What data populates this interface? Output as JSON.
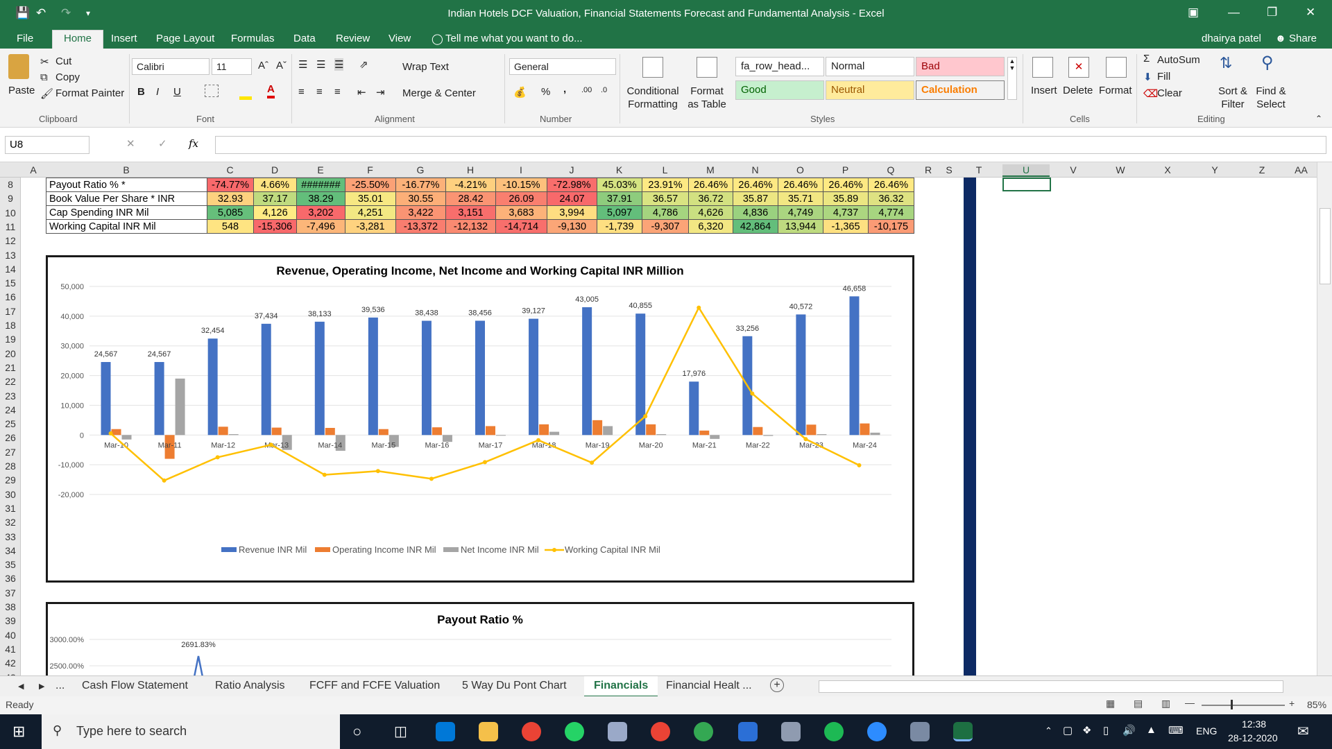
{
  "window": {
    "title": "Indian Hotels DCF Valuation, Financial Statements Forecast and Fundamental Analysis - Excel"
  },
  "menu": {
    "file": "File",
    "tabs": [
      "Home",
      "Insert",
      "Page Layout",
      "Formulas",
      "Data",
      "Review",
      "View"
    ],
    "tell_me": "Tell me what you want to do...",
    "user": "dhairya patel",
    "share": "Share"
  },
  "ribbon": {
    "paste": "Paste",
    "cut": "Cut",
    "copy": "Copy",
    "format_painter": "Format Painter",
    "clipboard": "Clipboard",
    "font_name": "Calibri",
    "font_size": "11",
    "bold": "B",
    "italic": "I",
    "underline": "U",
    "font": "Font",
    "wrap_text": "Wrap Text",
    "merge_center": "Merge & Center",
    "alignment": "Alignment",
    "number_format": "General",
    "percent": "%",
    "comma": ",",
    "number": "Number",
    "conditional_formatting": "Conditional Formatting",
    "format_as_table": "Format as Table",
    "style_names": [
      "fa_row_head...",
      "Normal",
      "Bad",
      "Good",
      "Neutral",
      "Calculation"
    ],
    "styles": "Styles",
    "insert": "Insert",
    "delete": "Delete",
    "format": "Format",
    "cells": "Cells",
    "autosum": "AutoSum",
    "fill": "Fill",
    "clear": "Clear",
    "sort_filter": "Sort & Filter",
    "find_select": "Find & Select",
    "editing": "Editing"
  },
  "formula_bar": {
    "name_box": "U8",
    "fx": "fx",
    "content": ""
  },
  "columns": [
    "A",
    "B",
    "C",
    "D",
    "E",
    "F",
    "G",
    "H",
    "I",
    "J",
    "K",
    "L",
    "M",
    "N",
    "O",
    "P",
    "Q",
    "R",
    "S",
    "T",
    "U",
    "V",
    "W",
    "X",
    "Y",
    "Z",
    "AA"
  ],
  "rows": [
    "8",
    "9",
    "10",
    "11",
    "12",
    "13",
    "14",
    "15",
    "16",
    "17",
    "18",
    "19",
    "20",
    "21",
    "22",
    "23",
    "24",
    "25",
    "26",
    "27",
    "28",
    "29",
    "30",
    "31",
    "32",
    "33",
    "34",
    "35",
    "36",
    "37",
    "38",
    "39",
    "40",
    "41",
    "42",
    "43"
  ],
  "table": [
    {
      "label": "Payout Ratio % *",
      "values": [
        "-74.77%",
        "4.66%",
        "#######",
        "-25.50%",
        "-16.77%",
        "-4.21%",
        "-10.15%",
        "-72.98%",
        "45.03%",
        "23.91%",
        "26.46%",
        "26.46%",
        "26.46%",
        "26.46%",
        "26.46%"
      ],
      "colors": [
        "#f8696b",
        "#fee382",
        "#63be7b",
        "#fba176",
        "#fcb179",
        "#fed07f",
        "#fdc07c",
        "#f86e6c",
        "#d5e382",
        "#fde983",
        "#fee983",
        "#fee983",
        "#fee983",
        "#fee983",
        "#fee983"
      ]
    },
    {
      "label": "Book Value Per Share * INR",
      "values": [
        "32.93",
        "37.17",
        "38.29",
        "35.01",
        "30.55",
        "28.42",
        "26.09",
        "24.07",
        "37.91",
        "36.57",
        "36.72",
        "35.87",
        "35.71",
        "35.89",
        "36.32"
      ],
      "colors": [
        "#fdd17f",
        "#bfdb7f",
        "#63be7b",
        "#f7e883",
        "#fcaf78",
        "#fa9473",
        "#f97f6f",
        "#f8696b",
        "#8ecc7d",
        "#d9e382",
        "#d3e181",
        "#ece682",
        "#f2e783",
        "#ebe682",
        "#dee282"
      ]
    },
    {
      "label": "Cap Spending INR Mil",
      "values": [
        "5,085",
        "4,126",
        "3,202",
        "4,251",
        "3,422",
        "3,151",
        "3,683",
        "3,994",
        "5,097",
        "4,786",
        "4,626",
        "4,836",
        "4,749",
        "4,737",
        "4,774"
      ],
      "colors": [
        "#66bf7b",
        "#feeb84",
        "#f8696b",
        "#f2e883",
        "#fa9473",
        "#f86e6c",
        "#fcb279",
        "#fedd81",
        "#63be7b",
        "#a5d47f",
        "#c9df81",
        "#9ad17f",
        "#aad580",
        "#acd680",
        "#a7d580"
      ]
    },
    {
      "label": "Working Capital INR Mil",
      "values": [
        "548",
        "-15,306",
        "-7,496",
        "-3,281",
        "-13,372",
        "-12,132",
        "-14,714",
        "-9,130",
        "-1,739",
        "-9,307",
        "6,320",
        "42,864",
        "13,944",
        "-1,365",
        "-10,175"
      ],
      "colors": [
        "#fee482",
        "#f8696b",
        "#fcb679",
        "#fed27f",
        "#f97d6f",
        "#fa8a71",
        "#f86f6c",
        "#fba677",
        "#fedf81",
        "#fba477",
        "#f2e783",
        "#63be7b",
        "#bedb80",
        "#fee081",
        "#fb9b75"
      ]
    }
  ],
  "chart_data": [
    {
      "type": "bar",
      "title": "Revenue, Operating Income, Net Income and Working Capital INR Million",
      "categories": [
        "Mar-10",
        "Mar-11",
        "Mar-12",
        "Mar-13",
        "Mar-14",
        "Mar-15",
        "Mar-16",
        "Mar-17",
        "Mar-18",
        "Mar-19",
        "Mar-20",
        "Mar-21",
        "Mar-22",
        "Mar-23",
        "Mar-24"
      ],
      "series": [
        {
          "name": "Revenue INR Mil",
          "type": "bar",
          "color": "#4472c4",
          "values": [
            24567,
            24567,
            32454,
            37434,
            38133,
            39536,
            38438,
            38456,
            39127,
            43005,
            40855,
            17976,
            33256,
            40572,
            46658
          ],
          "labels": [
            "24,567",
            "24,567",
            "32,454",
            "37,434",
            "38,133",
            "39,536",
            "38,438",
            "38,456",
            "39,127",
            "43,005",
            "40,855",
            "17,976",
            "33,256",
            "40,572",
            "46,658"
          ]
        },
        {
          "name": "Operating Income INR Mil",
          "type": "bar",
          "color": "#ed7d31",
          "values": [
            2000,
            -8000,
            2800,
            2500,
            2400,
            2000,
            2600,
            3000,
            3600,
            5000,
            3600,
            1500,
            2700,
            3500,
            3900
          ]
        },
        {
          "name": "Net Income INR Mil",
          "type": "bar",
          "color": "#a5a5a5",
          "values": [
            -1500,
            19000,
            300,
            -5000,
            -5300,
            -4000,
            -2300,
            -200,
            1100,
            3000,
            300,
            -1300,
            -300,
            300,
            800
          ]
        },
        {
          "name": "Working Capital INR Mil",
          "type": "line",
          "color": "#ffc000",
          "values": [
            548,
            -15306,
            -7496,
            -3281,
            -13372,
            -12132,
            -14714,
            -9130,
            -1739,
            -9307,
            6320,
            42864,
            13944,
            -1365,
            -10175
          ]
        }
      ],
      "ylim": [
        -20000,
        50000
      ],
      "yticks": [
        "50,000",
        "40,000",
        "30,000",
        "20,000",
        "10,000",
        "0",
        "-10,000",
        "-20,000"
      ],
      "legend": "bottom"
    },
    {
      "type": "line",
      "title": "Payout Ratio %",
      "yticks": [
        "3000.00%",
        "2500.00%"
      ],
      "peak_label": "2691.83%",
      "peak_value": 2691.83
    }
  ],
  "sheets": [
    "...",
    "Cash Flow Statement",
    "Ratio Analysis",
    "FCFF and FCFE Valuation",
    "5 Way Du Pont Chart",
    "Financials",
    "Financial Healt ..."
  ],
  "status": {
    "ready": "Ready",
    "zoom": "85%"
  },
  "taskbar": {
    "search": "Type here to search",
    "lang": "ENG",
    "time": "12:38",
    "date": "28-12-2020"
  }
}
